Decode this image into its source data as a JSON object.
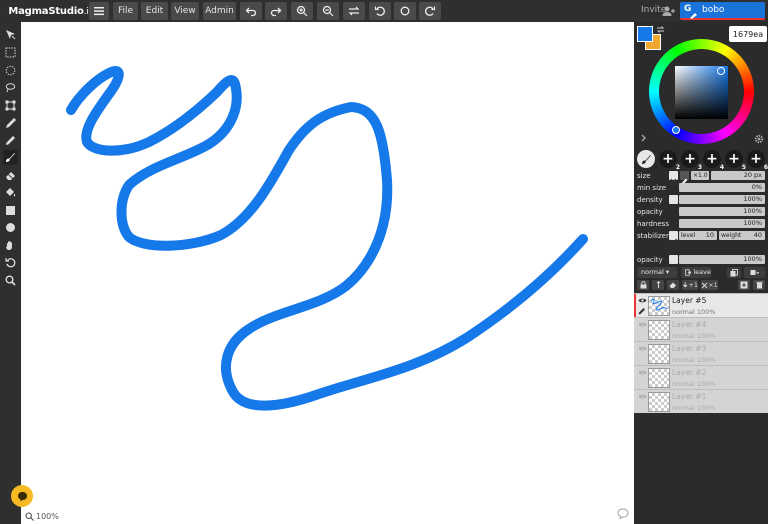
{
  "app": {
    "logo_name": "MagmaStudio",
    "logo_suffix": ".io"
  },
  "menu": {
    "file": "File",
    "edit": "Edit",
    "view": "View",
    "admin": "Admin"
  },
  "header": {
    "invite_label": "Invite",
    "user_initial": "G",
    "user_name": "bobo"
  },
  "canvas": {
    "zoom_label": "100%",
    "stroke_color": "#1679ea"
  },
  "color": {
    "hex": "1679ea",
    "foreground": "#1679ea",
    "background": "#f0a830"
  },
  "brush_slots": [
    "1",
    "2",
    "3",
    "4",
    "5",
    "6"
  ],
  "brush": {
    "size_label": "size",
    "size_mult": "×1.0",
    "size_value": "20 px",
    "min_size_label": "min size",
    "min_size_value": "0%",
    "density_label": "density",
    "density_value": "100%",
    "opacity_label": "opacity",
    "opacity_value": "100%",
    "hardness_label": "hardness",
    "hardness_value": "100%",
    "stabilizer_label": "stabilizer",
    "level_label": "level",
    "level_value": "10",
    "weight_label": "weight",
    "weight_value": "40"
  },
  "layer_opts": {
    "opacity_label": "opacity",
    "opacity_value": "100%",
    "blend_mode": "normal ▾",
    "leave_label": "leave",
    "add_label": "+1",
    "remove_label": "×1"
  },
  "layers": [
    {
      "name": "Layer #5",
      "meta": "normal 100%"
    },
    {
      "name": "Layer #4",
      "meta": "normal 100%"
    },
    {
      "name": "Layer #3",
      "meta": "normal 100%"
    },
    {
      "name": "Layer #2",
      "meta": "normal 100%"
    },
    {
      "name": "Layer #1",
      "meta": "normal 100%"
    }
  ]
}
